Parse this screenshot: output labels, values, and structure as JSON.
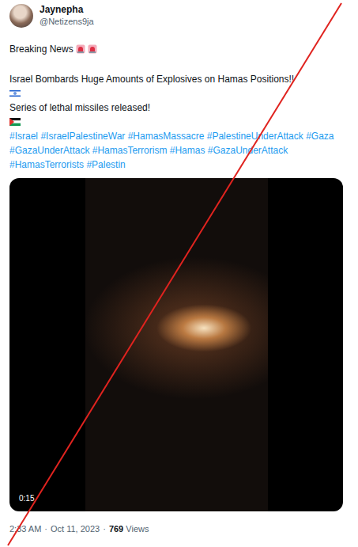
{
  "author": {
    "name": "Jaynepha",
    "handle": "@Netizens9ja"
  },
  "post": {
    "headline": "Breaking News",
    "title": "Israel Bombards Huge Amounts of Explosives on Hamas Positions!!",
    "subtitle": "Series of lethal missiles released!",
    "hashtags": [
      "#Israel",
      "#IsraelPalestineWar",
      "#HamasMassacre",
      "#PalestineUnderAttack",
      "#Gaza",
      "#GazaUnderAttack",
      "#HamasTerrorism",
      "#Hamas",
      "#GazaUnderAttack",
      "#HamasTerrorists",
      "#Palestin"
    ]
  },
  "video": {
    "duration": "0:15"
  },
  "meta": {
    "time": "2:33 AM",
    "separator": "·",
    "date": "Oct 11, 2023",
    "views": "769",
    "views_label": "Views"
  }
}
